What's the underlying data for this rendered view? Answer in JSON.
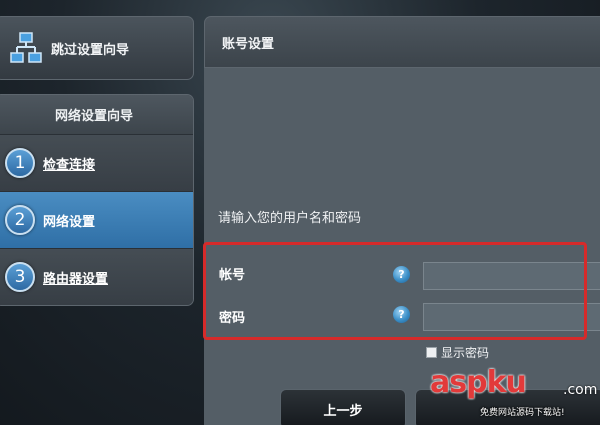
{
  "sidebar": {
    "skip_wizard_label": "跳过设置向导",
    "wizard_title": "网络设置向导",
    "steps": [
      {
        "number": "1",
        "label": "检查连接",
        "active": false
      },
      {
        "number": "2",
        "label": "网络设置",
        "active": true
      },
      {
        "number": "3",
        "label": "路由器设置",
        "active": false
      }
    ]
  },
  "panel": {
    "title": "账号设置",
    "instruction": "请输入您的用户名和密码",
    "account_label": "帐号",
    "password_label": "密码",
    "help_glyph": "?",
    "account_value": "",
    "password_value": "",
    "show_password_label": "显示密码"
  },
  "buttons": {
    "prev_label": "上一步",
    "next_label": ""
  },
  "watermark": {
    "brand": "aspku",
    "tld": ".com",
    "subtitle": "免费网站源码下载站!"
  },
  "colors": {
    "accent": "#2f6fa6",
    "highlight": "#d62a2a",
    "watermark": "#e23a3a"
  }
}
